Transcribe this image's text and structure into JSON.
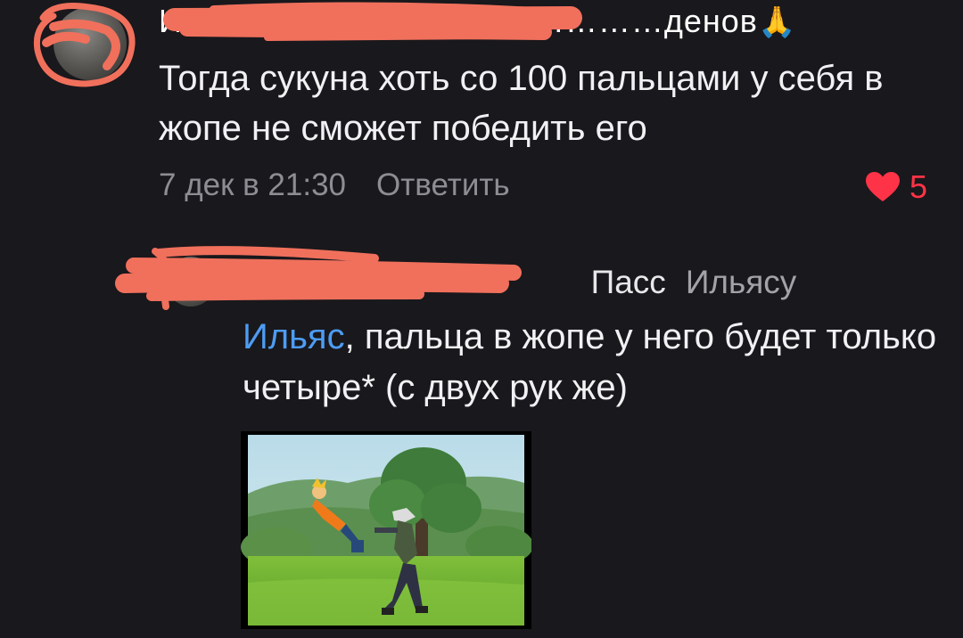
{
  "comment": {
    "author_visible": "Ил……………………………………денов",
    "author_emoji": "🙏",
    "text": "Тогда сукуна хоть со 100 пальцами у себя в жопе не сможет победить его",
    "date": "7 дек в 21:30",
    "reply_label": "Ответить",
    "likes": "5"
  },
  "reply": {
    "author_visible": "Пасс",
    "addressee": "Ильясу",
    "mention": "Ильяс",
    "text": ", пальца в жопе у него будет только четыре* (с двух рук же)"
  },
  "colors": {
    "background": "#19181c",
    "text": "#f1f1f3",
    "meta": "#8e8d93",
    "mention": "#4d9cf3",
    "like": "#ff3347",
    "redaction": "#f0705c"
  },
  "icons": {
    "like": "heart-icon",
    "avatar": "avatar-photo"
  }
}
